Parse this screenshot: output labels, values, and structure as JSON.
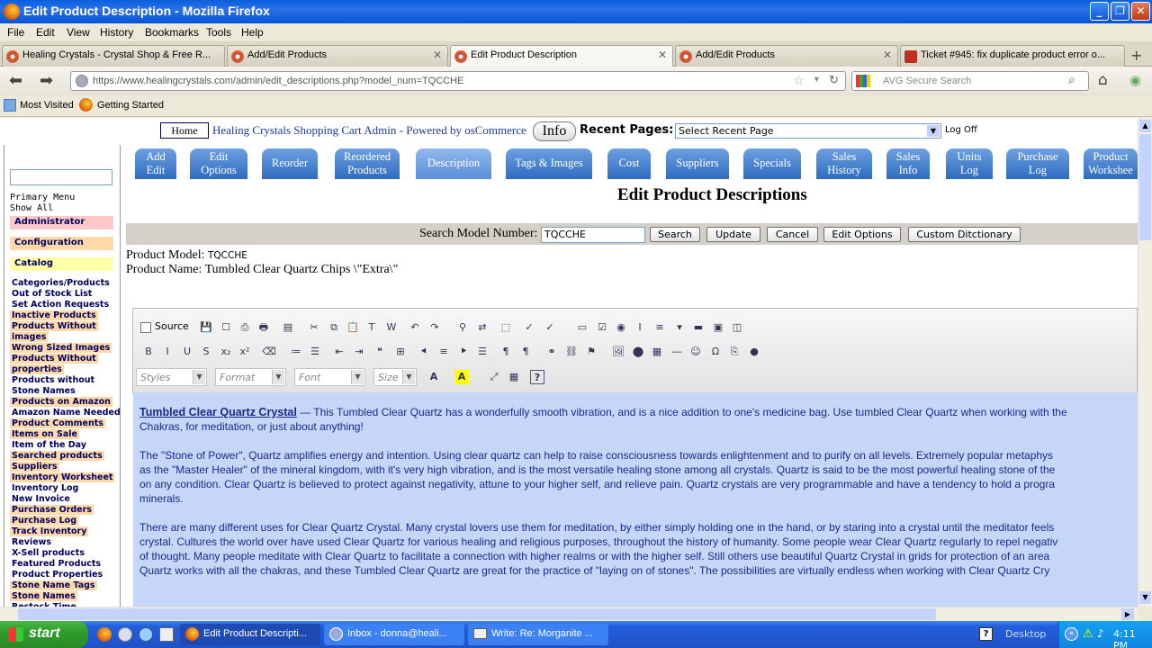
{
  "window": {
    "title": "Edit Product Description - Mozilla Firefox",
    "minimize_icon": "minimize-icon",
    "maximize_icon": "maximize-icon",
    "close_icon": "close-icon"
  },
  "menu": [
    "File",
    "Edit",
    "View",
    "History",
    "Bookmarks",
    "Tools",
    "Help"
  ],
  "tabs": [
    {
      "label": "Healing Crystals - Crystal Shop & Free R..."
    },
    {
      "label": "Add/Edit Products"
    },
    {
      "label": "Edit Product Description"
    },
    {
      "label": "Add/Edit Products"
    },
    {
      "label": "Ticket #945: fix duplicate product error o..."
    }
  ],
  "nav": {
    "url": "https://www.healingcrystals.com/admin/edit_descriptions.php?model_num=TQCCHE",
    "search_placeholder": "AVG Secure Search"
  },
  "bookmarks": [
    "Most Visited",
    "Getting Started"
  ],
  "admin": {
    "home": "Home",
    "header": "Healing Crystals Shopping Cart Admin - Powered by osCommerce",
    "info": "Info",
    "recent_label": "Recent Pages:",
    "recent_select": "Select Recent Page",
    "logoff": "Log Off"
  },
  "sidebar": {
    "primary_menu": "Primary Menu",
    "show_all": "Show All",
    "sections": [
      "Administrator",
      "Configuration",
      "Catalog"
    ],
    "items": [
      {
        "label": "Categories/Products",
        "hl": false
      },
      {
        "label": "Out of Stock List",
        "hl": false
      },
      {
        "label": "Set Action Requests",
        "hl": false
      },
      {
        "label": "Inactive Products",
        "hl": true
      },
      {
        "label": "Products Without",
        "hl": true
      },
      {
        "label": "images",
        "hl": true
      },
      {
        "label": "Wrong Sized Images",
        "hl": true
      },
      {
        "label": "Products Without",
        "hl": true
      },
      {
        "label": "properties",
        "hl": true
      },
      {
        "label": "Products without",
        "hl": false
      },
      {
        "label": "Stone Names",
        "hl": false
      },
      {
        "label": "Products on Amazon",
        "hl": true
      },
      {
        "label": "Amazon Name Needed",
        "hl": false
      },
      {
        "label": "Product Comments",
        "hl": true
      },
      {
        "label": "Items on Sale",
        "hl": true
      },
      {
        "label": "Item of the Day",
        "hl": false
      },
      {
        "label": "Searched products",
        "hl": true
      },
      {
        "label": "Suppliers",
        "hl": true
      },
      {
        "label": "Inventory Worksheet",
        "hl": true
      },
      {
        "label": "Inventory Log",
        "hl": false
      },
      {
        "label": "New Invoice",
        "hl": false
      },
      {
        "label": "Purchase Orders",
        "hl": true
      },
      {
        "label": "Purchase Log",
        "hl": true
      },
      {
        "label": "Track Inventory",
        "hl": true
      },
      {
        "label": "Reviews",
        "hl": false
      },
      {
        "label": "X-Sell products",
        "hl": false
      },
      {
        "label": "Featured Products",
        "hl": false
      },
      {
        "label": "Product Properties",
        "hl": false
      },
      {
        "label": "Stone Name Tags",
        "hl": true
      },
      {
        "label": "Stone Names",
        "hl": true
      },
      {
        "label": "Restock Time",
        "hl": false
      }
    ]
  },
  "navtabs": [
    {
      "l1": "Add",
      "l2": "Edit"
    },
    {
      "l1": "Edit",
      "l2": "Options"
    },
    {
      "l1": "Reorder",
      "l2": ""
    },
    {
      "l1": "Reordered",
      "l2": "Products"
    },
    {
      "l1": "Description",
      "l2": ""
    },
    {
      "l1": "Tags & Images",
      "l2": ""
    },
    {
      "l1": "Cost",
      "l2": ""
    },
    {
      "l1": "Suppliers",
      "l2": ""
    },
    {
      "l1": "Specials",
      "l2": ""
    },
    {
      "l1": "Sales",
      "l2": "History"
    },
    {
      "l1": "Sales",
      "l2": "Info"
    },
    {
      "l1": "Units",
      "l2": "Log"
    },
    {
      "l1": "Purchase",
      "l2": "Log"
    },
    {
      "l1": "Product",
      "l2": "Workshee"
    }
  ],
  "page": {
    "heading": "Edit Product Descriptions",
    "search_label": "Search Model Number:",
    "search_value": "TQCCHE",
    "buttons": [
      "Search",
      "Update",
      "Cancel",
      "Edit Options",
      "Custom Ditctionary"
    ],
    "model_label": "Product Model:",
    "model_value": "TQCCHE",
    "name_label": "Product Name:",
    "name_value": "Tumbled Clear Quartz Chips \\\"Extra\\\""
  },
  "editor": {
    "source_label": "Source",
    "combos": [
      "Styles",
      "Format",
      "Font",
      "Size"
    ],
    "title_link": "Tumbled Clear Quartz Crystal",
    "lines": [
      " — This Tumbled Clear Quartz has a wonderfully smooth vibration, and is a nice addition to one's medicine bag.  Use tumbled Clear Quartz when working with the",
      "Chakras, for meditation, or just about anything!",
      "The \"Stone of Power\", Quartz amplifies energy and intention.  Using clear quartz can help to raise consciousness towards enlightenment and to purify on all levels.  Extremely popular metaphys",
      "as the \"Master Healer\" of the mineral kingdom, with it's very high vibration, and is the most versatile healing stone among all crystals.  Quartz is said to be the most powerful healing stone of the",
      "on any condition.   Clear Quartz is believed to protect against negativity, attune to your higher self, and relieve pain.  Quartz crystals are very programmable and have a tendency to hold a progra",
      "minerals.",
      "There are many different uses for Clear Quartz Crystal.  Many crystal lovers use them for meditation, by either simply holding one in the hand, or by staring into a crystal until the meditator feels",
      "crystal.  Cultures the world over have used Clear Quartz for various healing and religious purposes, throughout the history of humanity.   Some people wear Clear Quartz regularly to repel negativ",
      "of thought.  Many people meditate with Clear Quartz to facilitate a connection with higher realms or with the higher self.  Still others use beautiful Quartz Crystal in grids for protection of an area",
      "Quartz works with all the chakras, and these Tumbled Clear Quartz are great for the practice of \"laying on of stones\".   The possibilities are virtually endless when working with Clear Quartz Cry"
    ]
  },
  "taskbar": {
    "start": "start",
    "tasks": [
      "Edit Product Descripti...",
      "Inbox - donna@heali...",
      "Write: Re: Morganite ..."
    ],
    "desktop": "Desktop",
    "clock": "4:11 PM"
  },
  "colors": {
    "title_blue": "#0a5fdd",
    "tab_blue": "#2e6cc0",
    "editor_bg": "#c5d6f7",
    "sidebar_hl": "#ffd9a8",
    "link_blue": "#1a2a8c"
  }
}
